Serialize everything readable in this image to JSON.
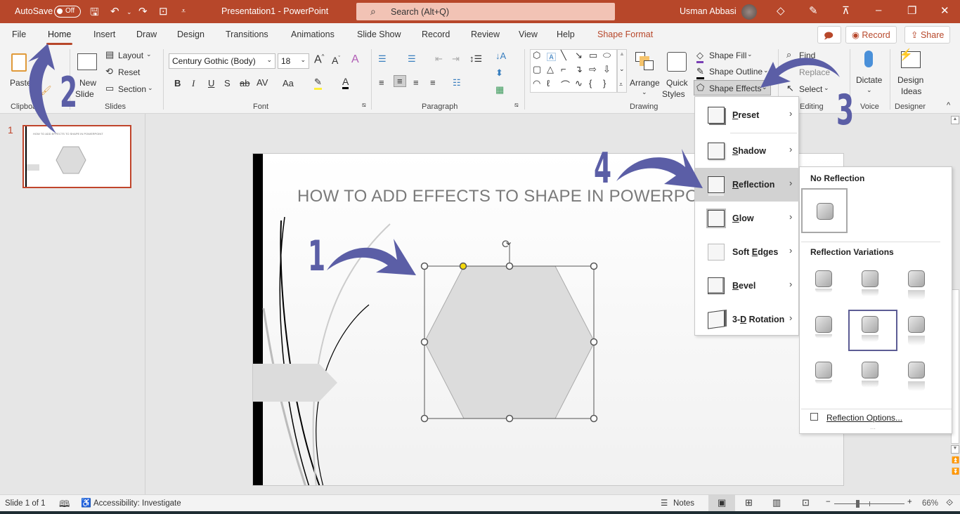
{
  "titlebar": {
    "autosave_label": "AutoSave",
    "autosave_state": "Off",
    "doc_title": "Presentation1  -  PowerPoint",
    "search_placeholder": "Search (Alt+Q)",
    "user_name": "Usman Abbasi",
    "icons": [
      "save-icon",
      "undo-icon",
      "redo-icon",
      "present-icon",
      "customize-qat-icon",
      "diamond-icon",
      "pen-icon",
      "ribbon-display-icon",
      "minimize-icon",
      "restore-icon",
      "close-icon"
    ]
  },
  "tabs": [
    {
      "label": "File"
    },
    {
      "label": "Home",
      "active": true
    },
    {
      "label": "Insert"
    },
    {
      "label": "Draw"
    },
    {
      "label": "Design"
    },
    {
      "label": "Transitions"
    },
    {
      "label": "Animations"
    },
    {
      "label": "Slide Show"
    },
    {
      "label": "Record"
    },
    {
      "label": "Review"
    },
    {
      "label": "View"
    },
    {
      "label": "Help"
    },
    {
      "label": "Shape Format",
      "contextual": true
    }
  ],
  "tab_actions": {
    "comments_icon": "comment-icon",
    "record": "Record",
    "share": "Share"
  },
  "ribbon": {
    "clipboard": {
      "paste": "Paste",
      "group": "Clipboard"
    },
    "slides": {
      "new_slide_1": "New",
      "new_slide_2": "Slide",
      "layout": "Layout",
      "reset": "Reset",
      "section": "Section",
      "group": "Slides"
    },
    "font": {
      "name": "Century Gothic (Body)",
      "size": "18",
      "group": "Font",
      "buttons": [
        "B",
        "I",
        "U",
        "S",
        "ab",
        "AV",
        "Aa"
      ]
    },
    "paragraph": {
      "group": "Paragraph"
    },
    "drawing": {
      "arrange": "Arrange",
      "quick_styles_1": "Quick",
      "quick_styles_2": "Styles",
      "shape_fill": "Shape Fill",
      "shape_outline": "Shape Outline",
      "shape_effects": "Shape Effects",
      "group": "Drawing"
    },
    "editing": {
      "find": "Find",
      "replace": "Replace",
      "select": "Select",
      "group": "Editing"
    },
    "voice": {
      "dictate": "Dictate",
      "group": "Voice"
    },
    "designer": {
      "design_ideas_1": "Design",
      "design_ideas_2": "Ideas",
      "group": "Designer"
    }
  },
  "thumbnail": {
    "number": "1",
    "title": "HOW TO ADD EFFECTS TO SHAPE IN POWERPOINT"
  },
  "slide": {
    "title": "HOW TO ADD EFFECTS TO SHAPE IN POWERPOIN"
  },
  "annotations": [
    "1",
    "2",
    "3",
    "4"
  ],
  "shape_effects_menu": [
    {
      "label": "Preset",
      "u": "P",
      "rest": "reset"
    },
    {
      "label": "Shadow",
      "u": "S",
      "rest": "hadow"
    },
    {
      "label": "Reflection",
      "u": "R",
      "rest": "eflection",
      "highlighted": true
    },
    {
      "label": "Glow",
      "u": "G",
      "rest": "low"
    },
    {
      "label": "Soft Edges",
      "pre": "Soft ",
      "u": "E",
      "rest": "dges"
    },
    {
      "label": "Bevel",
      "u": "B",
      "rest": "evel"
    },
    {
      "label": "3-D Rotation",
      "pre": "3-",
      "u": "D",
      "rest": " Rotation"
    }
  ],
  "reflection_submenu": {
    "no_reflection": "No Reflection",
    "variations": "Reflection Variations",
    "variation_count": 9,
    "selected_variation": 5,
    "options": "Reflection Options..."
  },
  "statusbar": {
    "slide_info": "Slide 1 of 1",
    "accessibility": "Accessibility: Investigate",
    "notes": "Notes",
    "zoom": "66%",
    "zoom_minus": "−",
    "zoom_plus": "+"
  },
  "colors": {
    "accent": "#b7472a",
    "annotation": "#5b5ea6",
    "selected_border": "#5c5c94"
  }
}
